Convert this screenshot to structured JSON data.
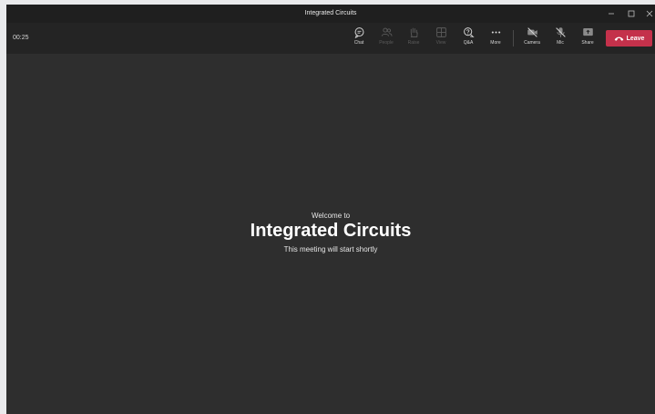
{
  "window": {
    "title": "Integrated Circuits"
  },
  "toolbar": {
    "timer": "00:25",
    "buttons": [
      {
        "id": "chat",
        "label": "Chat",
        "icon": "chat-icon",
        "enabled": true
      },
      {
        "id": "people",
        "label": "People",
        "icon": "people-icon",
        "enabled": false
      },
      {
        "id": "raise",
        "label": "Raise",
        "icon": "raise-hand-icon",
        "enabled": false
      },
      {
        "id": "view",
        "label": "View",
        "icon": "view-grid-icon",
        "enabled": false
      },
      {
        "id": "qa",
        "label": "Q&A",
        "icon": "qa-icon",
        "enabled": true
      },
      {
        "id": "more",
        "label": "More",
        "icon": "more-icon",
        "enabled": true
      },
      {
        "id": "camera",
        "label": "Camera",
        "icon": "camera-icon",
        "enabled": true
      },
      {
        "id": "mic",
        "label": "Mic",
        "icon": "mic-icon",
        "enabled": true
      },
      {
        "id": "share",
        "label": "Share",
        "icon": "share-icon",
        "enabled": true
      }
    ],
    "leave_label": "Leave"
  },
  "stage": {
    "welcome": "Welcome to",
    "meeting_name": "Integrated Circuits",
    "subtitle": "This meeting will start shortly"
  },
  "colors": {
    "leave_button": "#c4314b",
    "stage_background": "#2e2e2e",
    "toolbar_background": "#242424"
  }
}
